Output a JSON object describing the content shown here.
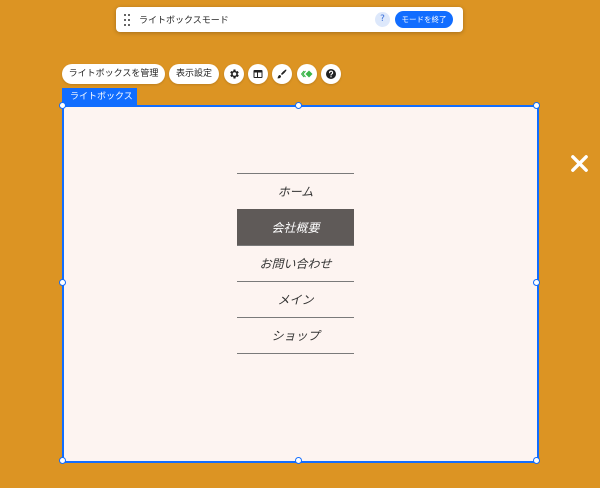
{
  "mode_bar": {
    "title": "ライトボックスモード",
    "help_label": "?",
    "exit_label": "モードを終了"
  },
  "toolbar": {
    "manage_label": "ライトボックスを管理",
    "display_settings_label": "表示設定",
    "icons": [
      "gear-icon",
      "layout-icon",
      "pen-icon",
      "animation-icon",
      "help-icon"
    ]
  },
  "lightbox": {
    "tag_label": "ライトボックス",
    "background": "#FDF4F1",
    "menu": [
      {
        "label": "ホーム",
        "active": false
      },
      {
        "label": "会社概要",
        "active": true
      },
      {
        "label": "お問い合わせ",
        "active": false
      },
      {
        "label": "メイン",
        "active": false
      },
      {
        "label": "ショップ",
        "active": false
      }
    ]
  },
  "colors": {
    "canvas": "#DC9423",
    "accent": "#116DFF",
    "active_menu_bg": "#5F5A58"
  }
}
